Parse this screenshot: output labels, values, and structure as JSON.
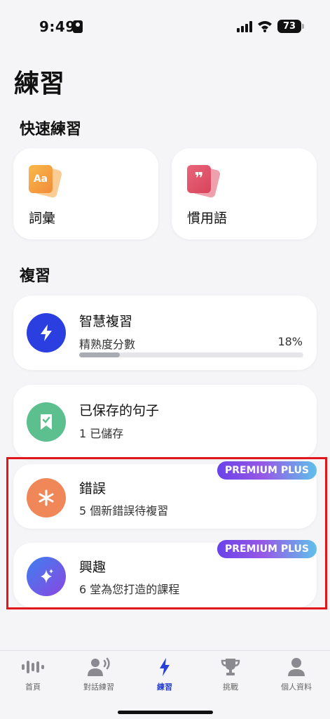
{
  "status_bar": {
    "time": "9:49",
    "battery": "73"
  },
  "page_title": "練習",
  "quick_practice": {
    "heading": "快速練習",
    "items": [
      {
        "label": "詞彙",
        "icon": "vocabulary-card-icon",
        "icon_text": "Aa",
        "color": "#f7a23c"
      },
      {
        "label": "慣用語",
        "icon": "idiom-quote-card-icon",
        "icon_text": "❞",
        "color": "#e0526a"
      }
    ]
  },
  "review": {
    "heading": "複習",
    "smart": {
      "title": "智慧複習",
      "subtitle": "精熟度分數",
      "percent_text": "18%",
      "progress": 0.18,
      "color": "#2b3fe0"
    },
    "saved": {
      "title": "已保存的句子",
      "subtitle": "1 已儲存",
      "color": "#5bbf8e"
    },
    "mistakes": {
      "title": "錯誤",
      "subtitle": "5 個新錯誤待複習",
      "badge": "PREMIUM PLUS",
      "color": "#ef8758"
    },
    "interests": {
      "title": "興趣",
      "subtitle": "6 堂為您打造的課程",
      "badge": "PREMIUM PLUS",
      "color": "#5a58e6"
    }
  },
  "tabs": [
    {
      "label": "首頁",
      "icon": "home-waveform-icon",
      "active": false
    },
    {
      "label": "對話練習",
      "icon": "speaking-person-icon",
      "active": false
    },
    {
      "label": "練習",
      "icon": "lightning-icon",
      "active": true
    },
    {
      "label": "挑戰",
      "icon": "trophy-icon",
      "active": false
    },
    {
      "label": "個人資料",
      "icon": "profile-icon",
      "active": false
    }
  ]
}
